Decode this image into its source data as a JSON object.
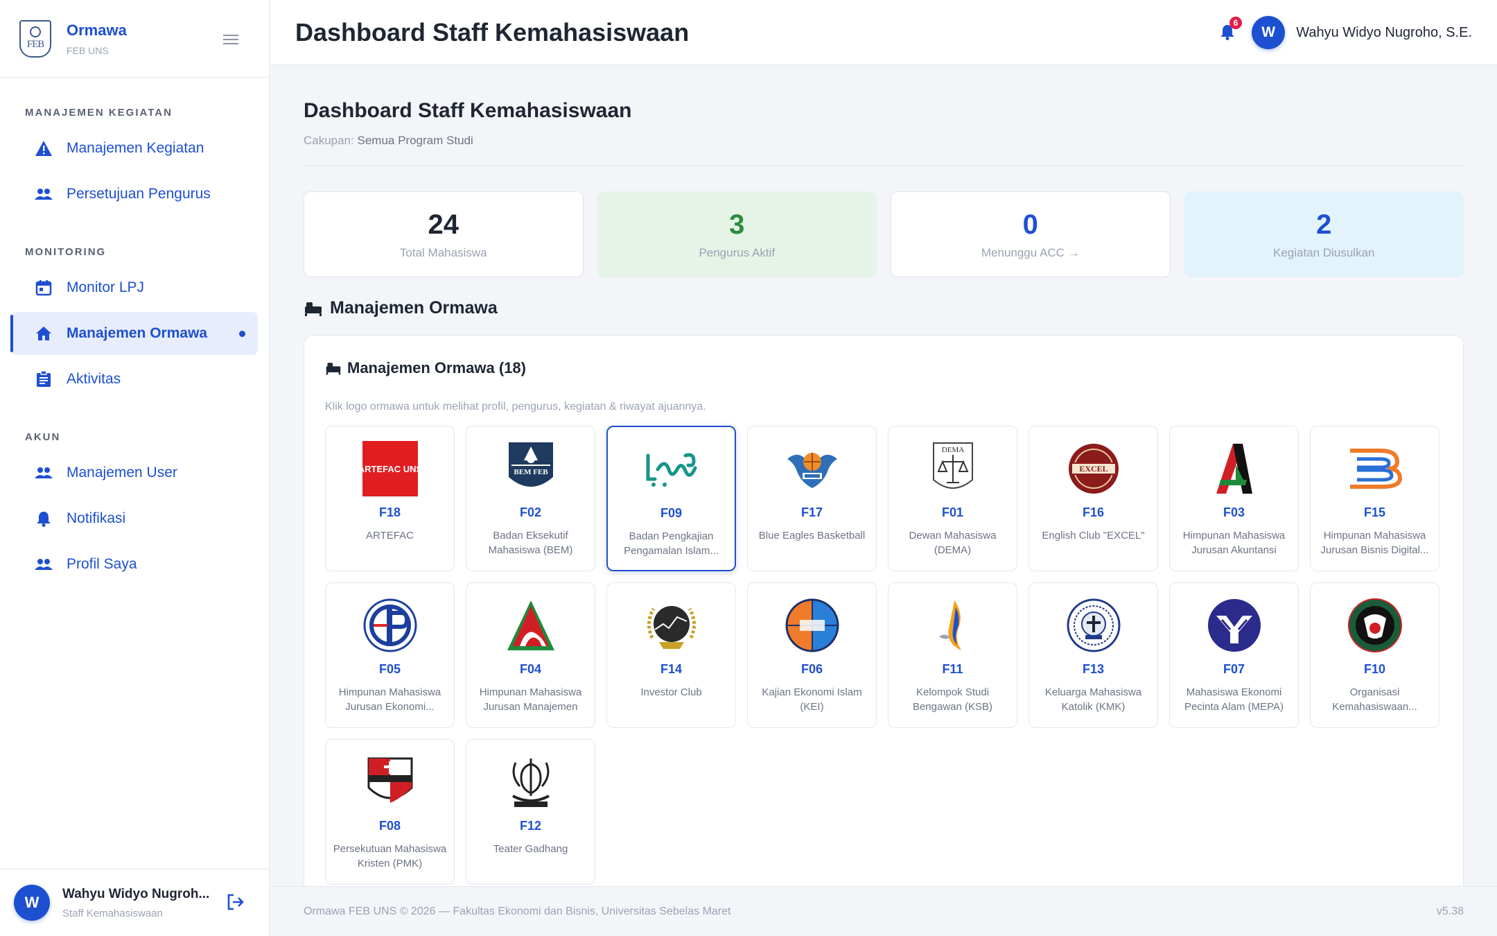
{
  "brand": {
    "name": "Ormawa",
    "sub": "FEB UNS",
    "logo_text": "FEB"
  },
  "sidebar": {
    "sections": [
      {
        "title": "MANAJEMEN KEGIATAN",
        "items": [
          {
            "label": "Manajemen Kegiatan",
            "icon": "warning-icon"
          },
          {
            "label": "Persetujuan Pengurus",
            "icon": "people-icon"
          }
        ]
      },
      {
        "title": "MONITORING",
        "items": [
          {
            "label": "Monitor LPJ",
            "icon": "calendar-icon"
          },
          {
            "label": "Manajemen Ormawa",
            "icon": "home-icon",
            "active": true
          },
          {
            "label": "Aktivitas",
            "icon": "clipboard-icon"
          }
        ]
      },
      {
        "title": "AKUN",
        "items": [
          {
            "label": "Manajemen User",
            "icon": "people-icon"
          },
          {
            "label": "Notifikasi",
            "icon": "bell-icon"
          },
          {
            "label": "Profil Saya",
            "icon": "people-icon"
          }
        ]
      }
    ],
    "user": {
      "initial": "W",
      "name": "Wahyu Widyo Nugroh...",
      "role": "Staff Kemahasiswaan"
    }
  },
  "header": {
    "title": "Dashboard Staff Kemahasiswaan",
    "notif_count": "6",
    "user_initial": "W",
    "user_name": "Wahyu Widyo Nugroho, S.E."
  },
  "main": {
    "title": "Dashboard Staff Kemahasiswaan",
    "scope_label": "Cakupan:",
    "scope_value": "Semua Program Studi",
    "stats": [
      {
        "value": "24",
        "label": "Total Mahasiswa",
        "style": "white"
      },
      {
        "value": "3",
        "label": "Pengurus Aktif",
        "style": "green"
      },
      {
        "value": "0",
        "label": "Menunggu ACC →",
        "style": "navy"
      },
      {
        "value": "2",
        "label": "Kegiatan Diusulkan",
        "style": "blue"
      }
    ],
    "section_title": "Manajemen Ormawa",
    "card_title": "Manajemen Ormawa (18)",
    "card_hint": "Klik logo ormawa untuk melihat profil, pengurus, kegiatan & riwayat ajuannya.",
    "orgs": [
      {
        "code": "F18",
        "name": "ARTEFAC",
        "logo": "artefac-logo",
        "logo_text": "ARTEFAC UNS"
      },
      {
        "code": "F02",
        "name": "Badan Eksekutif Mahasiswa (BEM)",
        "logo": "bem-logo",
        "logo_text": "BEM FEB"
      },
      {
        "code": "F09",
        "name": "Badan Pengkajian Pengamalan Islam...",
        "logo": "bppi-logo",
        "logo_text": "",
        "selected": true
      },
      {
        "code": "F17",
        "name": "Blue Eagles Basketball",
        "logo": "eagle-logo",
        "logo_text": ""
      },
      {
        "code": "F01",
        "name": "Dewan Mahasiswa (DEMA)",
        "logo": "dema-logo",
        "logo_text": "DEMA"
      },
      {
        "code": "F16",
        "name": "English Club \"EXCEL\"",
        "logo": "excel-logo",
        "logo_text": "EXCEL"
      },
      {
        "code": "F03",
        "name": "Himpunan Mahasiswa Jurusan Akuntansi",
        "logo": "hmja-logo",
        "logo_text": ""
      },
      {
        "code": "F15",
        "name": "Himpunan Mahasiswa Jurusan Bisnis Digital...",
        "logo": "hmjbd-logo",
        "logo_text": ""
      },
      {
        "code": "F05",
        "name": "Himpunan Mahasiswa Jurusan Ekonomi...",
        "logo": "hmje-logo",
        "logo_text": ""
      },
      {
        "code": "F04",
        "name": "Himpunan Mahasiswa Jurusan Manajemen",
        "logo": "hmjm-logo",
        "logo_text": ""
      },
      {
        "code": "F14",
        "name": "Investor Club",
        "logo": "investor-logo",
        "logo_text": ""
      },
      {
        "code": "F06",
        "name": "Kajian Ekonomi Islam (KEI)",
        "logo": "kei-logo",
        "logo_text": ""
      },
      {
        "code": "F11",
        "name": "Kelompok Studi Bengawan (KSB)",
        "logo": "ksb-logo",
        "logo_text": ""
      },
      {
        "code": "F13",
        "name": "Keluarga Mahasiswa Katolik (KMK)",
        "logo": "kmk-logo",
        "logo_text": ""
      },
      {
        "code": "F07",
        "name": "Mahasiswa Ekonomi Pecinta Alam (MEPA)",
        "logo": "mepa-logo",
        "logo_text": ""
      },
      {
        "code": "F10",
        "name": "Organisasi Kemahasiswaan...",
        "logo": "ok-logo",
        "logo_text": ""
      },
      {
        "code": "F08",
        "name": "Persekutuan Mahasiswa Kristen (PMK)",
        "logo": "pmk-logo",
        "logo_text": ""
      },
      {
        "code": "F12",
        "name": "Teater Gadhang",
        "logo": "teater-logo",
        "logo_text": ""
      }
    ]
  },
  "footer": {
    "text": "Ormawa FEB UNS © 2026 — Fakultas Ekonomi dan Bisnis, Universitas Sebelas Maret",
    "version": "v5.38"
  },
  "colors": {
    "accent": "#1d4fd1",
    "green": "#2e8b3f",
    "badge": "#e11d48"
  }
}
